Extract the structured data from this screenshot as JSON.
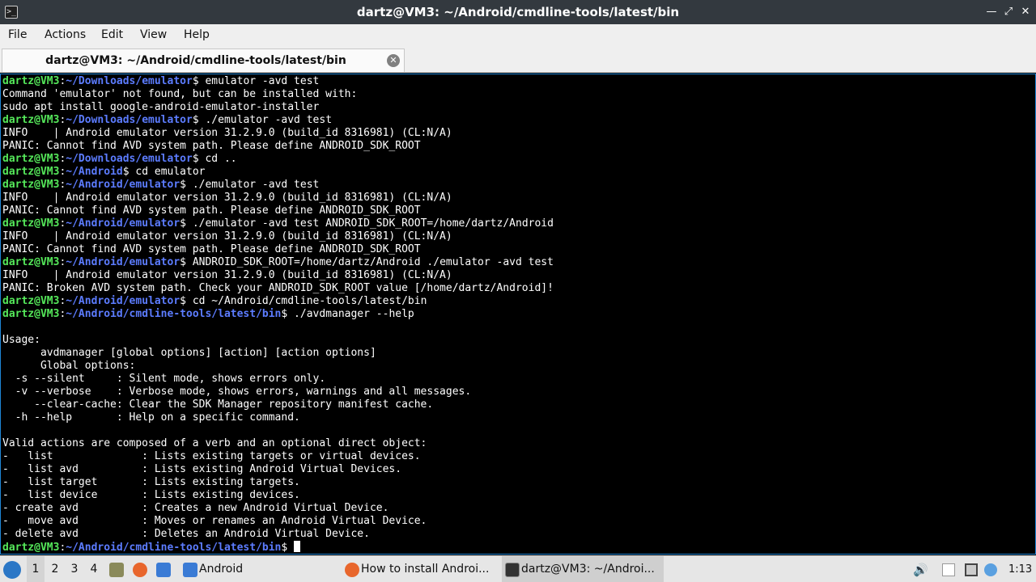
{
  "window": {
    "title": "dartz@VM3: ~/Android/cmdline-tools/latest/bin",
    "icon": "terminal-icon"
  },
  "menu": {
    "file": "File",
    "actions": "Actions",
    "edit": "Edit",
    "view": "View",
    "help": "Help"
  },
  "tab": {
    "label": "dartz@VM3: ~/Android/cmdline-tools/latest/bin",
    "close_icon": "close-circle-icon"
  },
  "terminal": {
    "prompt_user": "dartz@VM3",
    "lines": [
      {
        "p": "~/Downloads/emulator",
        "t": " emulator -avd test"
      },
      {
        "t": "Command 'emulator' not found, but can be installed with:"
      },
      {
        "t": "sudo apt install google-android-emulator-installer"
      },
      {
        "p": "~/Downloads/emulator",
        "t": " ./emulator -avd test"
      },
      {
        "t": "INFO    | Android emulator version 31.2.9.0 (build_id 8316981) (CL:N/A)"
      },
      {
        "t": "PANIC: Cannot find AVD system path. Please define ANDROID_SDK_ROOT"
      },
      {
        "p": "~/Downloads/emulator",
        "t": " cd .."
      },
      {
        "p": "~/Android",
        "t": " cd emulator"
      },
      {
        "p": "~/Android/emulator",
        "t": " ./emulator -avd test"
      },
      {
        "t": "INFO    | Android emulator version 31.2.9.0 (build_id 8316981) (CL:N/A)"
      },
      {
        "t": "PANIC: Cannot find AVD system path. Please define ANDROID_SDK_ROOT"
      },
      {
        "p": "~/Android/emulator",
        "t": " ./emulator -avd test ANDROID_SDK_ROOT=/home/dartz/Android"
      },
      {
        "t": "INFO    | Android emulator version 31.2.9.0 (build_id 8316981) (CL:N/A)"
      },
      {
        "t": "PANIC: Cannot find AVD system path. Please define ANDROID_SDK_ROOT"
      },
      {
        "p": "~/Android/emulator",
        "t": " ANDROID_SDK_ROOT=/home/dartz/Android ./emulator -avd test"
      },
      {
        "t": "INFO    | Android emulator version 31.2.9.0 (build_id 8316981) (CL:N/A)"
      },
      {
        "t": "PANIC: Broken AVD system path. Check your ANDROID_SDK_ROOT value [/home/dartz/Android]!"
      },
      {
        "p": "~/Android/emulator",
        "t": " cd ~/Android/cmdline-tools/latest/bin"
      },
      {
        "p": "~/Android/cmdline-tools/latest/bin",
        "t": " ./avdmanager --help"
      },
      {
        "t": ""
      },
      {
        "t": "Usage:"
      },
      {
        "t": "      avdmanager [global options] [action] [action options]"
      },
      {
        "t": "      Global options:"
      },
      {
        "t": "  -s --silent     : Silent mode, shows errors only."
      },
      {
        "t": "  -v --verbose    : Verbose mode, shows errors, warnings and all messages."
      },
      {
        "t": "     --clear-cache: Clear the SDK Manager repository manifest cache."
      },
      {
        "t": "  -h --help       : Help on a specific command."
      },
      {
        "t": ""
      },
      {
        "t": "Valid actions are composed of a verb and an optional direct object:"
      },
      {
        "t": "-   list              : Lists existing targets or virtual devices."
      },
      {
        "t": "-   list avd          : Lists existing Android Virtual Devices."
      },
      {
        "t": "-   list target       : Lists existing targets."
      },
      {
        "t": "-   list device       : Lists existing devices."
      },
      {
        "t": "- create avd          : Creates a new Android Virtual Device."
      },
      {
        "t": "-   move avd          : Moves or renames an Android Virtual Device."
      },
      {
        "t": "- delete avd          : Deletes an Android Virtual Device."
      },
      {
        "p": "~/Android/cmdline-tools/latest/bin",
        "t": " ",
        "cursor": true
      }
    ]
  },
  "taskbar": {
    "start_icon": "start-menu-icon",
    "workspaces": [
      "1",
      "2",
      "3",
      "4"
    ],
    "quick_launch": [
      "file-manager-icon",
      "firefox-icon",
      "desktop-icon"
    ],
    "tasks": [
      {
        "label": "Android",
        "icon": "folder-icon"
      },
      {
        "label": "How to install Androi...",
        "icon": "firefox-icon"
      },
      {
        "label": "dartz@VM3: ~/Androi...",
        "icon": "terminal-icon"
      }
    ],
    "tray": [
      "volume-icon",
      "clipboard-icon",
      "display-icon",
      "network-icon"
    ],
    "clock": "1:13"
  },
  "colors": {
    "prompt_user": "#55e85a",
    "prompt_path": "#5c7cff",
    "terminal_bg": "#000000",
    "titlebar_bg": "#33393f"
  }
}
